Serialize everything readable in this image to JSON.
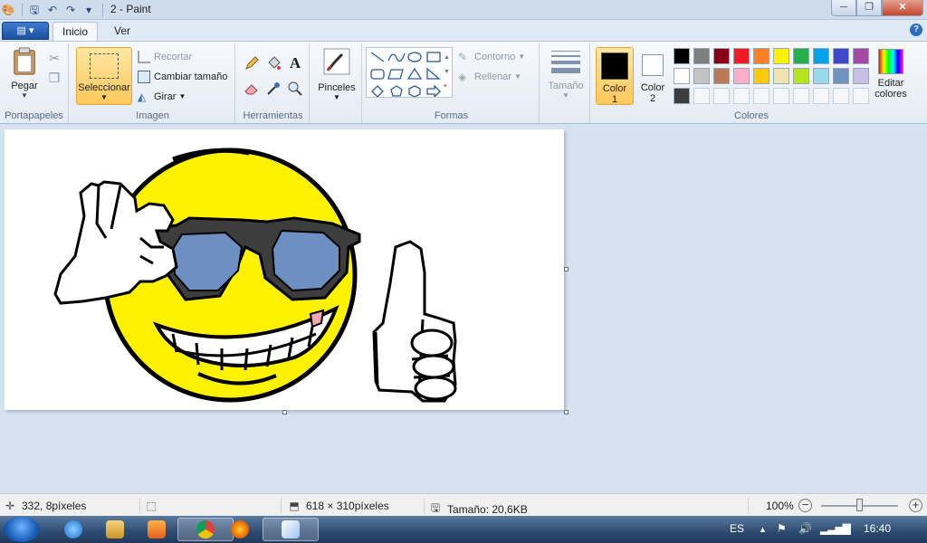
{
  "window": {
    "title": "2 - Paint",
    "controls": {
      "minimize": "─",
      "maximize": "❐",
      "close": "✕"
    }
  },
  "tabs": {
    "app_menu": "▤ ▾",
    "home": "Inicio",
    "view": "Ver"
  },
  "ribbon": {
    "clipboard": {
      "paste": "Pegar",
      "label": "Portapapeles"
    },
    "image": {
      "select": "Seleccionar",
      "crop": "Recortar",
      "resize": "Cambiar tamaño",
      "rotate": "Girar",
      "label": "Imagen"
    },
    "tools": {
      "label": "Herramientas",
      "text_glyph": "A"
    },
    "brushes": {
      "label": "Pinceles"
    },
    "shapes": {
      "outline": "Contorno",
      "fill": "Rellenar",
      "label": "Formas"
    },
    "size": {
      "label": "Tamaño"
    },
    "colors": {
      "color1_line1": "Color",
      "color1_line2": "1",
      "color2_line1": "Color",
      "color2_line2": "2",
      "edit_line1": "Editar",
      "edit_line2": "colores",
      "label": "Colores",
      "palette_row1": [
        "#000000",
        "#7f7f7f",
        "#880015",
        "#ed1c24",
        "#ff7f27",
        "#fff200",
        "#22b14c",
        "#00a2e8",
        "#3f48cc",
        "#a349a4"
      ],
      "palette_row2": [
        "#ffffff",
        "#c3c3c3",
        "#b97a57",
        "#ffaec9",
        "#ffc90e",
        "#efe4b0",
        "#b5e61d",
        "#99d9ea",
        "#7092be",
        "#c8bfe7"
      ],
      "palette_row3": [
        "#3c3c3c",
        "",
        "",
        "",
        "",
        "",
        "",
        "",
        "",
        ""
      ]
    }
  },
  "status": {
    "cursor": "332, 8píxeles",
    "dimensions": "618 × 310píxeles",
    "file_size": "Tamaño: 20,6KB",
    "zoom": "100%"
  },
  "taskbar": {
    "language": "ES",
    "time": "16:40"
  }
}
